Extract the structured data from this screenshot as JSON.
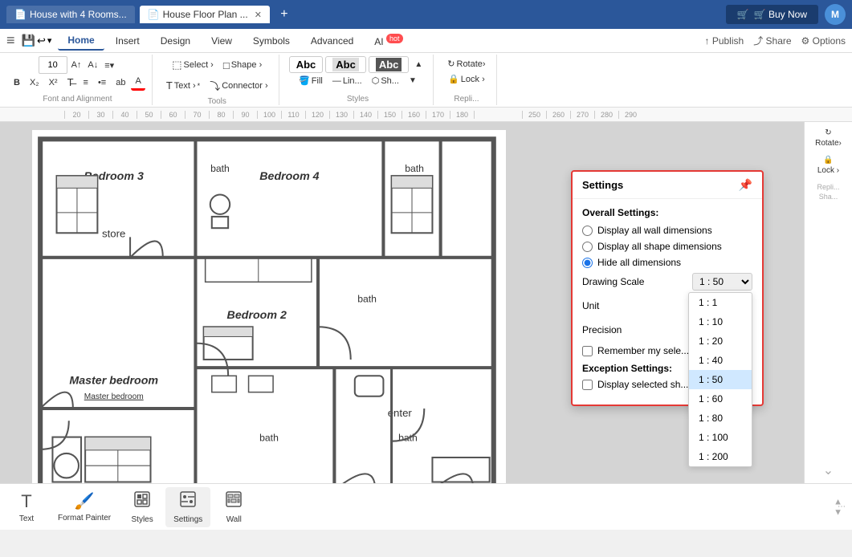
{
  "title_bar": {
    "tabs": [
      {
        "label": "House with 4 Rooms...",
        "active": false,
        "icon": "📄"
      },
      {
        "label": "House Floor Plan ...",
        "active": true,
        "icon": "📄"
      }
    ],
    "buy_now": "🛒 Buy Now",
    "avatar_label": "M"
  },
  "ribbon": {
    "tabs": [
      {
        "label": "Home",
        "active": true
      },
      {
        "label": "Insert",
        "active": false
      },
      {
        "label": "Design",
        "active": false
      },
      {
        "label": "View",
        "active": false
      },
      {
        "label": "Symbols",
        "active": false
      },
      {
        "label": "Advanced",
        "active": false
      },
      {
        "label": "AI",
        "active": false,
        "hot": true
      }
    ],
    "right_actions": [
      "Publish",
      "Share",
      "Options"
    ]
  },
  "toolbar": {
    "font_size": "10",
    "groups": {
      "font_alignment": "Font and Alignment",
      "tools": "Tools",
      "styles": "Styles",
      "replace": "Repli..."
    },
    "buttons": {
      "select": "Select ›",
      "shape": "Shape ›",
      "text": "Text ›",
      "connector": "Connector ›",
      "rotate": "Rotate›",
      "lock": "Lock ›",
      "fill": "Fill",
      "line": "Lin...",
      "sh": "Sh..."
    }
  },
  "styles_bar": {
    "abc_styles": [
      "Abc",
      "Abc",
      "Abc"
    ]
  },
  "ruler": {
    "marks": [
      "20",
      "30",
      "40",
      "50",
      "60",
      "70",
      "80",
      "90",
      "100",
      "110",
      "120",
      "130",
      "140",
      "150",
      "160",
      "170",
      "180",
      "250",
      "260",
      "270",
      "280",
      "290"
    ]
  },
  "settings_panel": {
    "title": "Settings",
    "overall_title": "Overall Settings:",
    "radio_options": [
      {
        "label": "Display all wall dimensions",
        "value": "wall",
        "checked": false
      },
      {
        "label": "Display all shape dimensions",
        "value": "shape",
        "checked": false
      },
      {
        "label": "Hide all dimensions",
        "value": "hide",
        "checked": true
      }
    ],
    "drawing_scale_label": "Drawing Scale",
    "drawing_scale_value": "1 : 50",
    "unit_label": "Unit",
    "precision_label": "Precision",
    "remember_label": "Remember my sele...",
    "exception_title": "Exception Settings:",
    "display_selected_label": "Display selected sh...",
    "scale_options": [
      {
        "label": "1 : 1",
        "value": "1:1"
      },
      {
        "label": "1 : 10",
        "value": "1:10"
      },
      {
        "label": "1 : 20",
        "value": "1:20"
      },
      {
        "label": "1 : 40",
        "value": "1:40"
      },
      {
        "label": "1 : 50",
        "value": "1:50",
        "selected": true
      },
      {
        "label": "1 : 60",
        "value": "1:60"
      },
      {
        "label": "1 : 80",
        "value": "1:80"
      },
      {
        "label": "1 : 100",
        "value": "1:100"
      },
      {
        "label": "1 : 200",
        "value": "1:200"
      }
    ]
  },
  "bottom_toolbar": {
    "tools": [
      {
        "label": "Text",
        "icon": "T"
      },
      {
        "label": "Format Painter",
        "icon": "🖌"
      },
      {
        "label": "Styles",
        "icon": "◻"
      },
      {
        "label": "Settings",
        "icon": "⚙",
        "active": true
      },
      {
        "label": "Wall",
        "icon": "▦"
      }
    ]
  },
  "floor_plan": {
    "rooms": [
      "Bedroom 3",
      "Bedroom 4",
      "store",
      "Bedroom 2",
      "Master bedroom",
      "enter"
    ],
    "bathrooms": [
      "bath",
      "bath",
      "bath",
      "bath",
      "bath"
    ]
  },
  "colors": {
    "accent_blue": "#2b579a",
    "accent_red": "#e53935",
    "selected_blue": "#d0e8ff",
    "radio_blue": "#1a73e8"
  }
}
